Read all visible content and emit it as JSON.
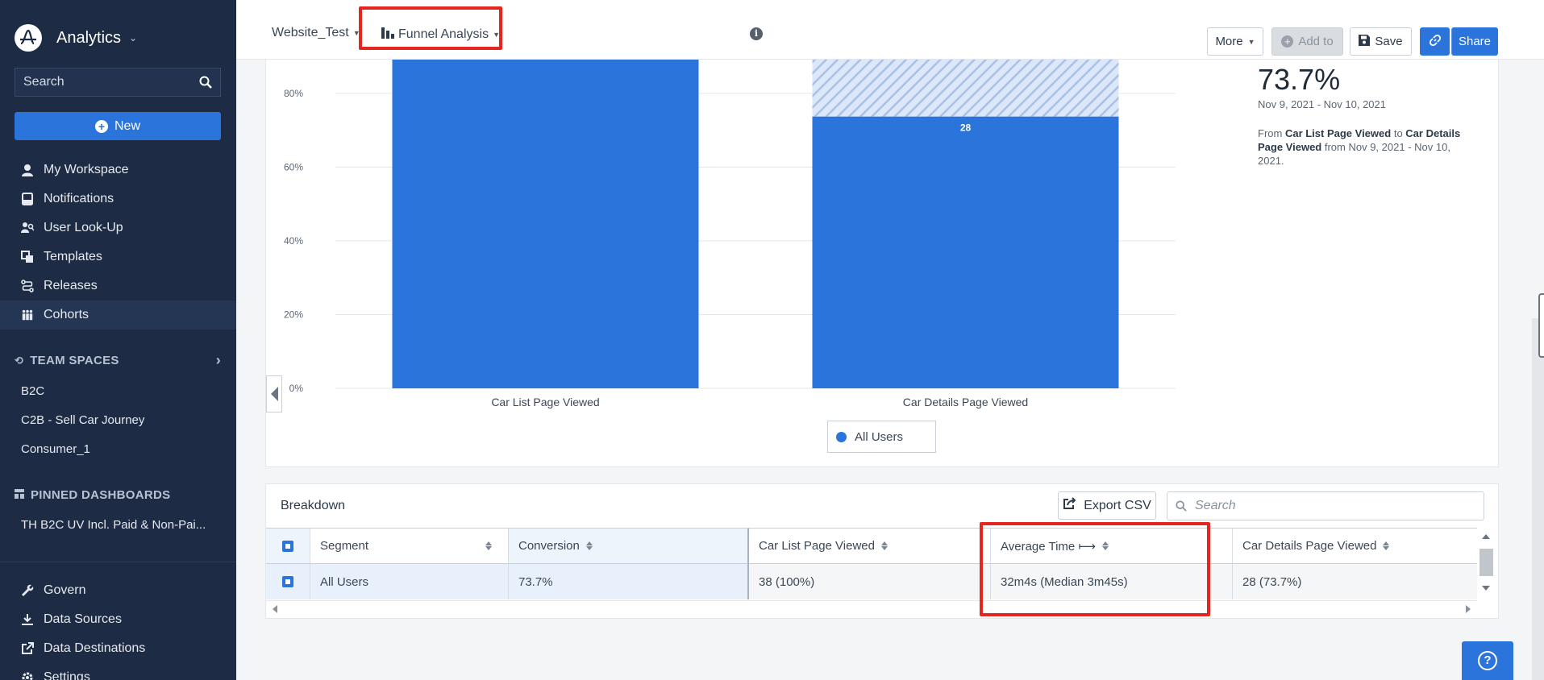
{
  "app": {
    "name": "Analytics"
  },
  "sidebar": {
    "search_placeholder": "Search",
    "new_label": "New",
    "nav": [
      {
        "label": "My Workspace",
        "icon": "user-icon"
      },
      {
        "label": "Notifications",
        "icon": "inbox-icon"
      },
      {
        "label": "User Look-Up",
        "icon": "user-lookup-icon"
      },
      {
        "label": "Templates",
        "icon": "templates-icon"
      },
      {
        "label": "Releases",
        "icon": "releases-icon"
      },
      {
        "label": "Cohorts",
        "icon": "cohorts-icon"
      }
    ],
    "team_spaces": {
      "header": "TEAM SPACES",
      "items": [
        "B2C",
        "C2B - Sell Car Journey",
        "Consumer_1"
      ]
    },
    "pinned": {
      "header": "PINNED DASHBOARDS",
      "items": [
        "TH B2C UV Incl. Paid & Non-Pai..."
      ]
    },
    "bottom": [
      {
        "label": "Govern",
        "icon": "wrench-icon"
      },
      {
        "label": "Data Sources",
        "icon": "download-icon"
      },
      {
        "label": "Data Destinations",
        "icon": "export-icon"
      },
      {
        "label": "Settings",
        "icon": "gear-icon"
      }
    ]
  },
  "topbar": {
    "project": "Website_Test",
    "chart_type": "Funnel Analysis",
    "more_label": "More",
    "add_to_label": "Add to",
    "save_label": "Save",
    "share_label": "Share"
  },
  "chart_data": {
    "type": "bar",
    "categories": [
      "Car List Page Viewed",
      "Car Details Page Viewed"
    ],
    "values": [
      100,
      73.7
    ],
    "dropoff": [
      0,
      26.3
    ],
    "data_labels": [
      "",
      "28"
    ],
    "y_ticks": [
      "0%",
      "20%",
      "40%",
      "60%",
      "80%"
    ],
    "ylim": [
      0,
      100
    ],
    "legend": [
      "All Users"
    ],
    "colors": {
      "bar": "#2a74db",
      "dropoff": "#c5d6f2"
    }
  },
  "summary": {
    "conversion": "73.7%",
    "date_range": "Nov 9, 2021 - Nov 10, 2021",
    "desc_prefix": "From ",
    "desc_from": "Car List Page Viewed",
    "desc_to_word": " to ",
    "desc_to": "Car Details Page Viewed",
    "desc_suffix": " from Nov 9, 2021 - Nov 10, 2021."
  },
  "breakdown": {
    "title": "Breakdown",
    "export_label": "Export CSV",
    "search_placeholder": "Search",
    "columns": [
      "Segment",
      "Conversion",
      "Car List Page Viewed",
      "Average Time ⟼",
      "Car Details Page Viewed"
    ],
    "rows": [
      {
        "segment": "All Users",
        "conversion": "73.7%",
        "step1": "38 (100%)",
        "avg_time": "32m4s (Median 3m45s)",
        "step2": "28 (73.7%)"
      }
    ]
  }
}
